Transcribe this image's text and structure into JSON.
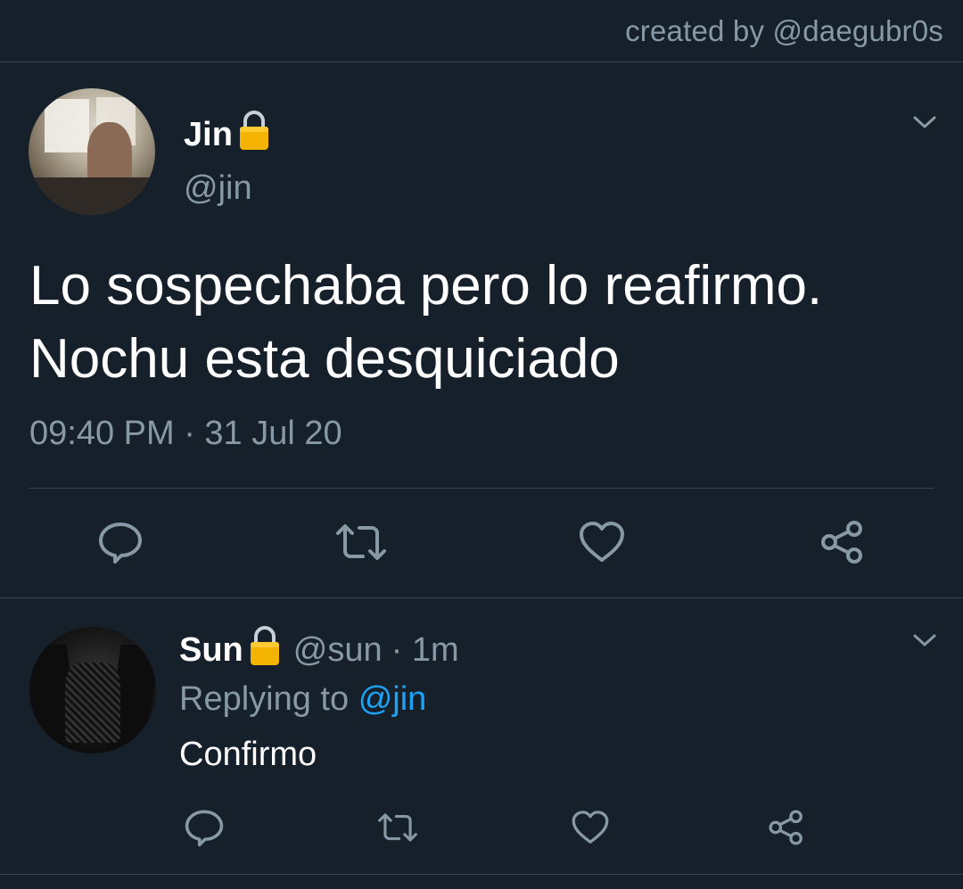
{
  "credit": "created by @daegubr0s",
  "main_tweet": {
    "name": "Jin",
    "handle": "@jin",
    "text_line1": "Lo sospechaba pero lo reafirmo.",
    "text_line2": "Nochu esta desquiciado",
    "meta": "09:40 PM · 31 Jul 20",
    "avatar_icon": "profile-photo-man-at-desk",
    "lock_icon": "lock-icon"
  },
  "reply": {
    "name": "Sun",
    "handle": "@sun",
    "time": "· 1m",
    "replying_prefix": "Replying to",
    "replying_mention": "@jin",
    "text": "Confirmo",
    "avatar_icon": "profile-photo-lace-top"
  },
  "actions": [
    "reply-icon",
    "retweet-icon",
    "like-icon",
    "share-icon"
  ],
  "colors": {
    "background": "#15202b",
    "text": "#ffffff",
    "secondary": "#8899a6",
    "mention": "#1da1f2",
    "divider": "#38444d",
    "lock": "#f5b301"
  }
}
